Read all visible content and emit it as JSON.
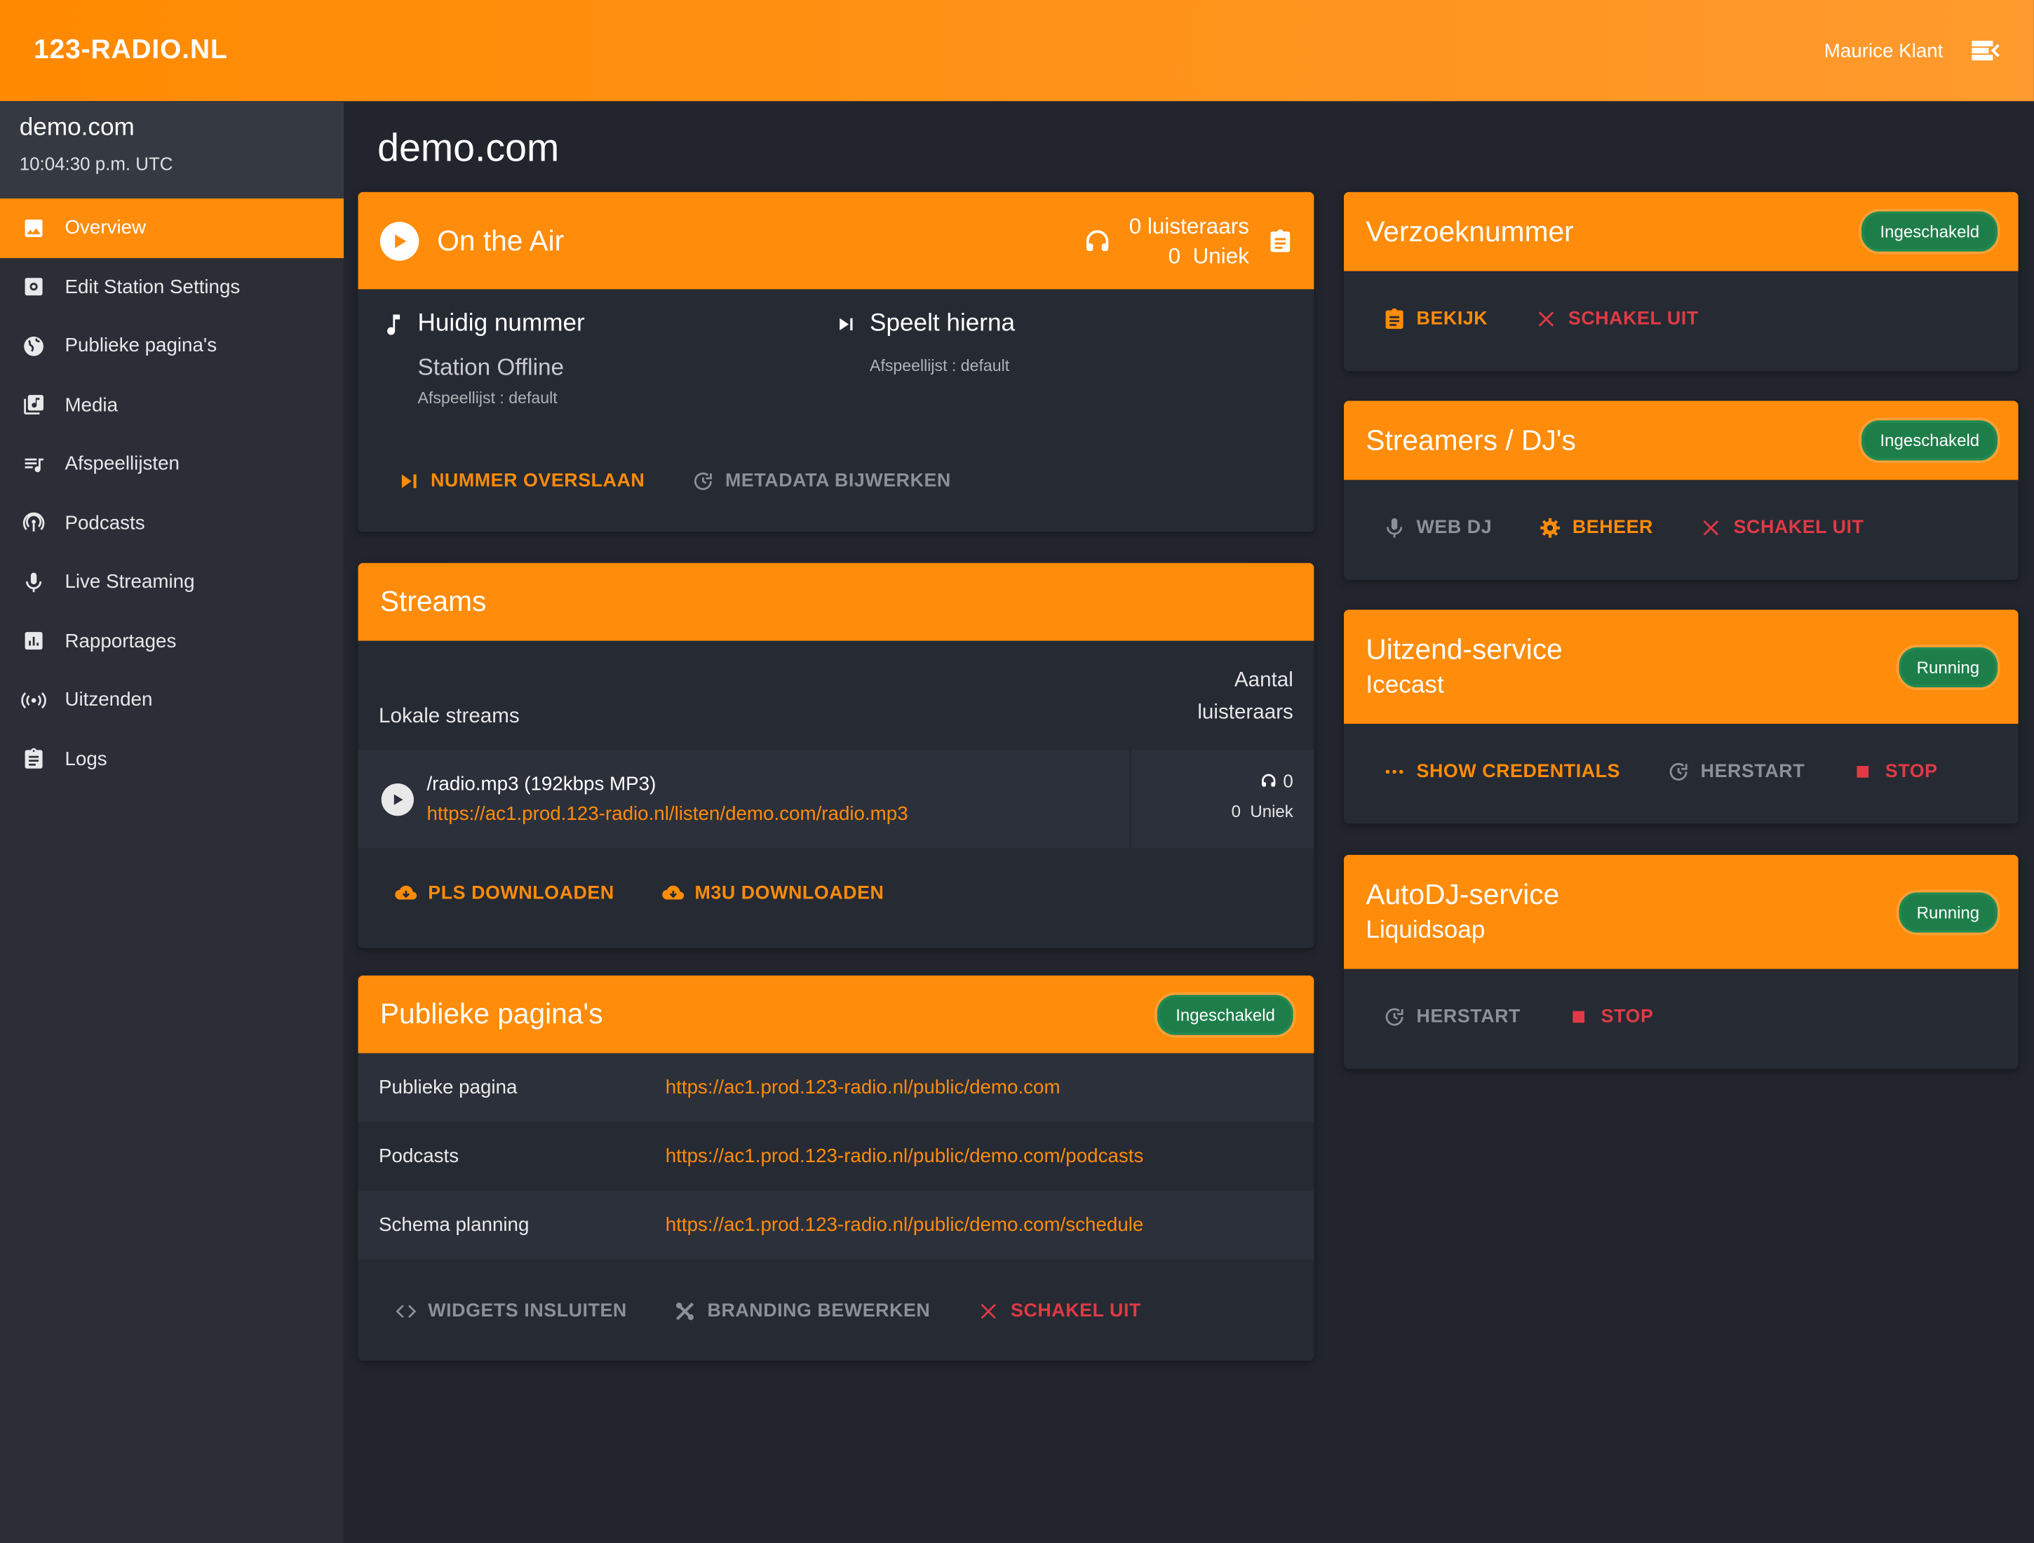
{
  "header": {
    "brand": "123-RADIO.NL",
    "user": "Maurice Klant"
  },
  "sidebar": {
    "station": "demo.com",
    "time": "10:04:30 p.m. UTC",
    "items": [
      {
        "label": "Overview",
        "icon": "image-icon"
      },
      {
        "label": "Edit Station Settings",
        "icon": "settings-icon"
      },
      {
        "label": "Publieke pagina's",
        "icon": "globe-icon"
      },
      {
        "label": "Media",
        "icon": "library-icon"
      },
      {
        "label": "Afspeellijsten",
        "icon": "queue-music-icon"
      },
      {
        "label": "Podcasts",
        "icon": "podcast-icon"
      },
      {
        "label": "Live Streaming",
        "icon": "mic-icon"
      },
      {
        "label": "Rapportages",
        "icon": "chart-icon"
      },
      {
        "label": "Uitzenden",
        "icon": "broadcast-icon"
      },
      {
        "label": "Logs",
        "icon": "clipboard-icon"
      }
    ]
  },
  "page": {
    "title": "demo.com"
  },
  "onair": {
    "title": "On the Air",
    "listeners": "0 luisteraars",
    "unique": "0  Uniek",
    "current_title": "Huidig nummer",
    "current_song": "Station Offline",
    "current_playlist": "Afspeellijst : default",
    "next_title": "Speelt hierna",
    "next_playlist": "Afspeellijst : default",
    "skip": "NUMMER OVERSLAAN",
    "metadata": "METADATA BIJWERKEN"
  },
  "streams": {
    "title": "Streams",
    "col_left": "Lokale streams",
    "col_right_1": "Aantal",
    "col_right_2": "luisteraars",
    "row_name": "/radio.mp3 (192kbps MP3)",
    "row_url": "https://ac1.prod.123-radio.nl/listen/demo.com/radio.mp3",
    "row_listeners": "0",
    "row_unique": "0  Uniek",
    "pls": "PLS DOWNLOADEN",
    "m3u": "M3U DOWNLOADEN"
  },
  "public": {
    "title": "Publieke pagina's",
    "badge": "Ingeschakeld",
    "rows": [
      {
        "k": "Publieke pagina",
        "v": "https://ac1.prod.123-radio.nl/public/demo.com"
      },
      {
        "k": "Podcasts",
        "v": "https://ac1.prod.123-radio.nl/public/demo.com/podcasts"
      },
      {
        "k": "Schema planning",
        "v": "https://ac1.prod.123-radio.nl/public/demo.com/schedule"
      }
    ],
    "widgets": "WIDGETS INSLUITEN",
    "branding": "BRANDING BEWERKEN",
    "disable": "SCHAKEL UIT"
  },
  "requests": {
    "title": "Verzoeknummer",
    "badge": "Ingeschakeld",
    "view": "BEKIJK",
    "disable": "SCHAKEL UIT"
  },
  "streamers": {
    "title": "Streamers / DJ's",
    "badge": "Ingeschakeld",
    "webdj": "WEB DJ",
    "manage": "BEHEER",
    "disable": "SCHAKEL UIT"
  },
  "broadcast": {
    "title": "Uitzend-service",
    "sub": "Icecast",
    "badge": "Running",
    "creds": "SHOW CREDENTIALS",
    "restart": "HERSTART",
    "stop": "STOP"
  },
  "autodj": {
    "title": "AutoDJ-service",
    "sub": "Liquidsoap",
    "badge": "Running",
    "restart": "HERSTART",
    "stop": "STOP"
  },
  "colors": {
    "accent": "#ff8c0a",
    "background": "#22252d",
    "success": "#1e7e4a",
    "danger": "#e03a45"
  }
}
